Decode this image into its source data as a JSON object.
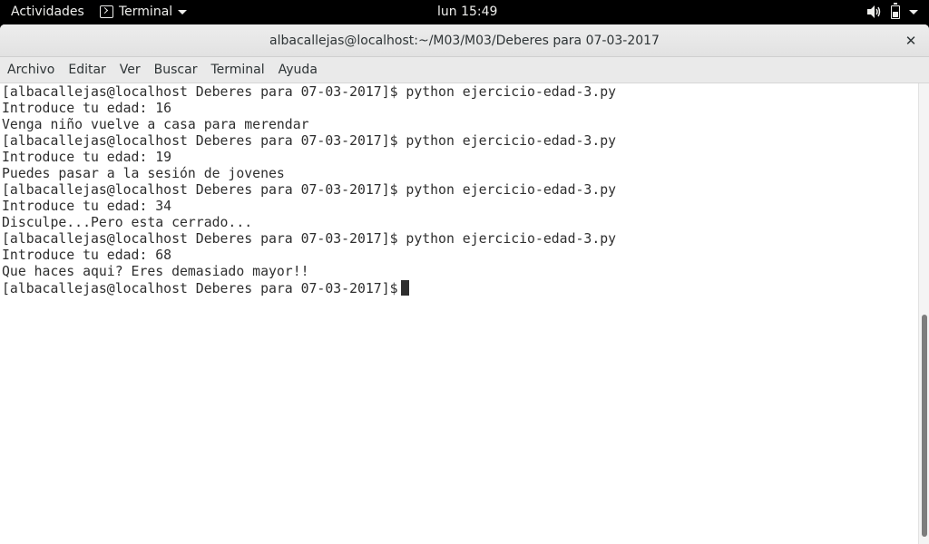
{
  "topbar": {
    "activities": "Actividades",
    "app_name": "Terminal",
    "clock": "lun 15:49",
    "icons": [
      "terminal-icon",
      "volume-icon",
      "battery-icon",
      "system-menu-chevron-icon"
    ]
  },
  "window": {
    "title": "albacallejas@localhost:~/M03/M03/Deberes para 07-03-2017",
    "close_glyph": "✕"
  },
  "menubar": {
    "items": [
      "Archivo",
      "Editar",
      "Ver",
      "Buscar",
      "Terminal",
      "Ayuda"
    ]
  },
  "terminal": {
    "lines": [
      "[albacallejas@localhost Deberes para 07-03-2017]$ python ejercicio-edad-3.py",
      "Introduce tu edad: 16",
      "Venga niño vuelve a casa para merendar",
      "[albacallejas@localhost Deberes para 07-03-2017]$ python ejercicio-edad-3.py",
      "Introduce tu edad: 19",
      "Puedes pasar a la sesión de jovenes",
      "[albacallejas@localhost Deberes para 07-03-2017]$ python ejercicio-edad-3.py",
      "Introduce tu edad: 34",
      "Disculpe...Pero esta cerrado...",
      "[albacallejas@localhost Deberes para 07-03-2017]$ python ejercicio-edad-3.py",
      "Introduce tu edad: 68",
      "Que haces aqui? Eres demasiado mayor!!"
    ],
    "prompt": "[albacallejas@localhost Deberes para 07-03-2017]$"
  },
  "colors": {
    "topbar_bg": "#000000",
    "terminal_bg": "#ffffff",
    "terminal_fg": "#2e2e2e"
  }
}
